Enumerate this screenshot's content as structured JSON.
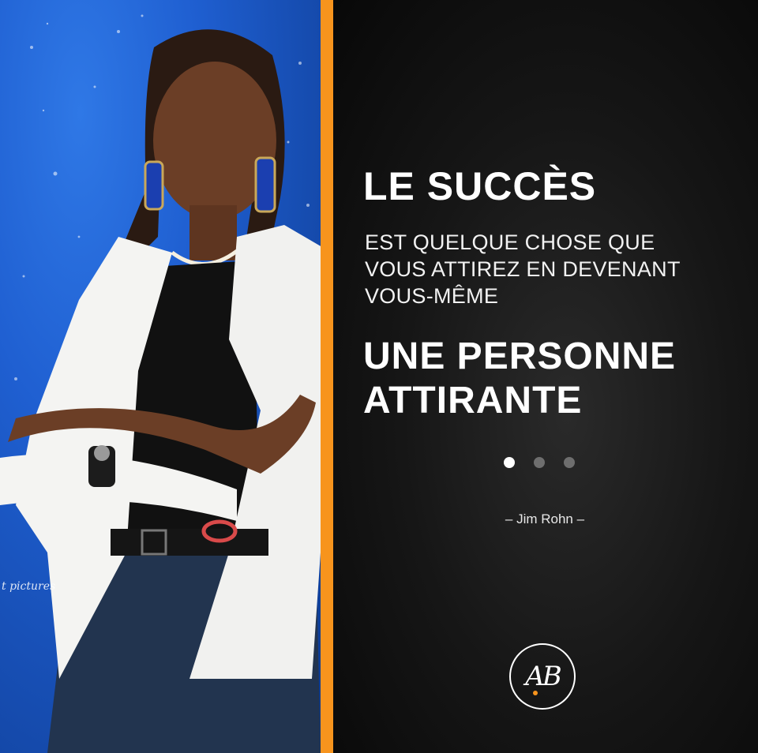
{
  "photo": {
    "watermark": "t pictures",
    "colors": {
      "background": "#1f5fd1",
      "blazer": "#f4f4f2",
      "top": "#111111",
      "jeans": "#22344f",
      "skin": "#6b3e26"
    }
  },
  "accent_color": "#f7941d",
  "quote": {
    "headline": "LE SUCCÈS",
    "body_lines": [
      "EST QUELQUE CHOSE QUE",
      "VOUS ATTIREZ EN DEVENANT",
      "VOUS-MÊME"
    ],
    "emphasis_lines": [
      "UNE PERSONNE",
      "ATTIRANTE"
    ],
    "author": "– Jim Rohn –"
  },
  "carousel": {
    "count": 3,
    "active_index": 0
  },
  "logo": {
    "text": "AB"
  }
}
